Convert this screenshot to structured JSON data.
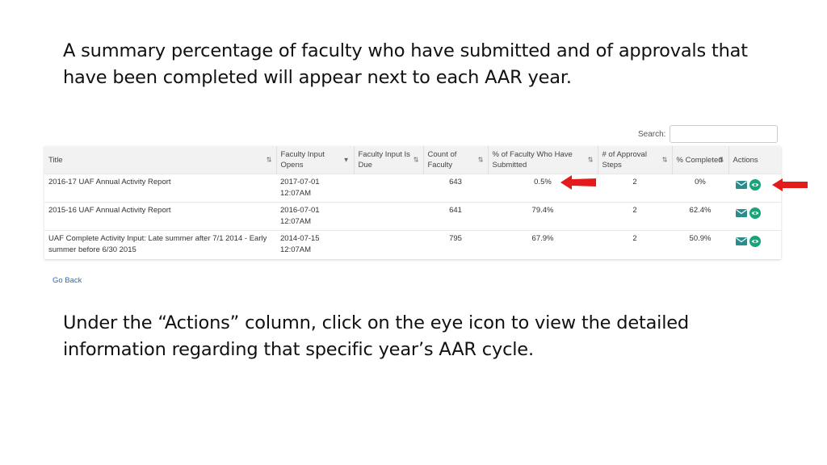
{
  "slide": {
    "intro_text": "A summary percentage of faculty who have submitted and of approvals that have been completed will appear next to each AAR year.",
    "instruction_text": "Under the “Actions” column, click on the eye icon to view the detailed information regarding that specific year’s AAR cycle."
  },
  "search": {
    "label": "Search:",
    "value": "",
    "placeholder": ""
  },
  "table": {
    "columns": [
      {
        "label": "Title",
        "sort": "⇅"
      },
      {
        "label": "Faculty Input Opens",
        "sort": "▼"
      },
      {
        "label": "Faculty Input Is Due",
        "sort": "⇅"
      },
      {
        "label": "Count of Faculty",
        "sort": "⇅"
      },
      {
        "label": "% of Faculty Who Have Submitted",
        "sort": "⇅"
      },
      {
        "label": "# of Approval Steps",
        "sort": "⇅"
      },
      {
        "label": "% Completed",
        "sort": "⇅"
      },
      {
        "label": "Actions",
        "sort": ""
      }
    ],
    "rows": [
      {
        "title": "2016-17 UAF Annual Activity Report",
        "opens": "2017-07-01 12:07AM",
        "due": "",
        "count": "643",
        "pct_submitted": "0.5%",
        "steps": "2",
        "pct_completed": "0%"
      },
      {
        "title": "2015-16 UAF Annual Activity Report",
        "opens": "2016-07-01 12:07AM",
        "due": "",
        "count": "641",
        "pct_submitted": "79.4%",
        "steps": "2",
        "pct_completed": "62.4%"
      },
      {
        "title": "UAF Complete Activity Input: Late summer after 7/1 2014 - Early summer before 6/30 2015",
        "opens": "2014-07-15 12:07AM",
        "due": "",
        "count": "795",
        "pct_submitted": "67.9%",
        "steps": "2",
        "pct_completed": "50.9%"
      }
    ],
    "action_icons": [
      "mail-icon",
      "eye-icon"
    ]
  },
  "footer": {
    "go_back_label": "Go Back"
  },
  "colors": {
    "arrow": "#e31b1b",
    "eye": "#1aa37a",
    "mail": "#2a8c8c",
    "link": "#2a6db3"
  }
}
